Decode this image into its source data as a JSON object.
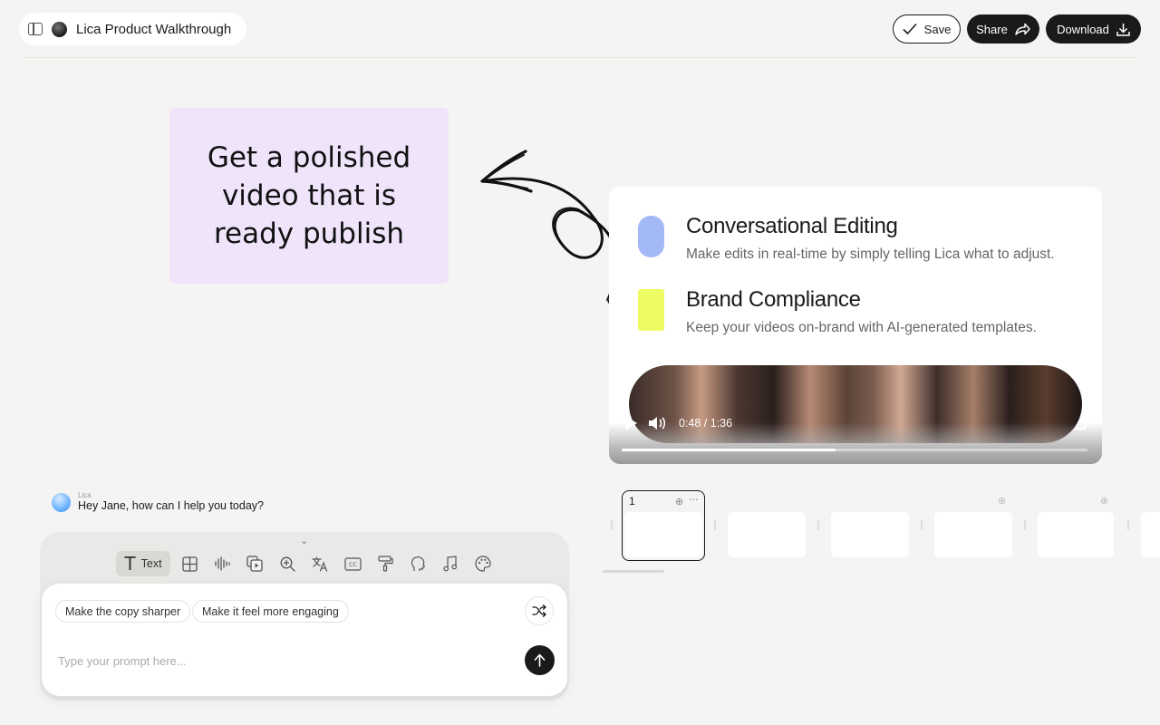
{
  "header": {
    "project_title": "Lica Product Walkthrough",
    "save_label": "Save",
    "share_label": "Share",
    "download_label": "Download"
  },
  "callout": {
    "text": "Get a polished video that is ready publish"
  },
  "features": [
    {
      "title": "Conversational Editing",
      "description": "Make edits in real-time by simply telling Lica what to adjust.",
      "color": "#a3b8f7"
    },
    {
      "title": "Brand Compliance",
      "description": "Keep your videos on-brand with AI-generated templates.",
      "color": "#eefb62"
    }
  ],
  "video": {
    "time": "0:48 / 1:36",
    "progress": 0.46
  },
  "timeline": {
    "active_slide_number": "1"
  },
  "chat": {
    "assistant_name": "Lica",
    "assistant_message": "Hey Jane, how can I help you today?",
    "tools": [
      {
        "name": "text",
        "label": "Text",
        "icon": "text-icon"
      },
      {
        "name": "layout",
        "icon": "layout-icon"
      },
      {
        "name": "audio",
        "icon": "waveform-icon"
      },
      {
        "name": "media",
        "icon": "media-icon"
      },
      {
        "name": "zoom",
        "icon": "zoom-icon"
      },
      {
        "name": "translate",
        "icon": "translate-icon"
      },
      {
        "name": "captions",
        "icon": "captions-icon"
      },
      {
        "name": "brush",
        "icon": "paint-roller-icon"
      },
      {
        "name": "avatar",
        "icon": "head-icon"
      },
      {
        "name": "music",
        "icon": "music-icon"
      },
      {
        "name": "palette",
        "icon": "palette-icon"
      }
    ],
    "suggestions": [
      "Make the copy sharper",
      "Make it feel more engaging"
    ],
    "prompt_placeholder": "Type your prompt here..."
  }
}
